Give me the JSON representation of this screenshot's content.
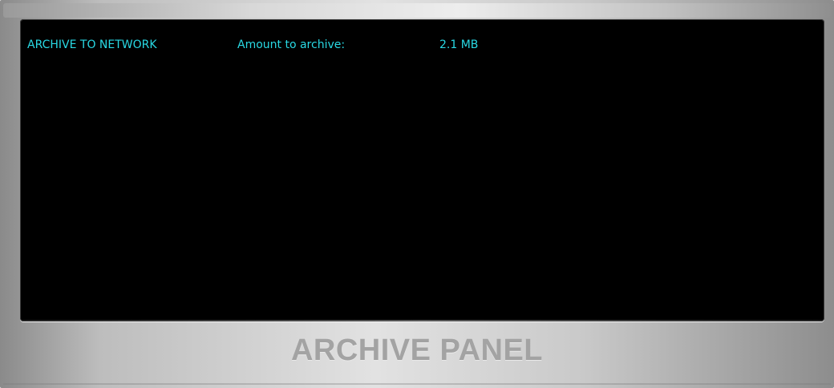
{
  "archive": {
    "title": "ARCHIVE TO NETWORK",
    "amount_label": "Amount to archive:",
    "amount_value": "2.1 MB"
  },
  "panel": {
    "label": "ARCHIVE PANEL"
  },
  "colors": {
    "text_accent": "#29d9e4",
    "screen_background": "#000000",
    "panel_label": "#a3a3a3"
  }
}
